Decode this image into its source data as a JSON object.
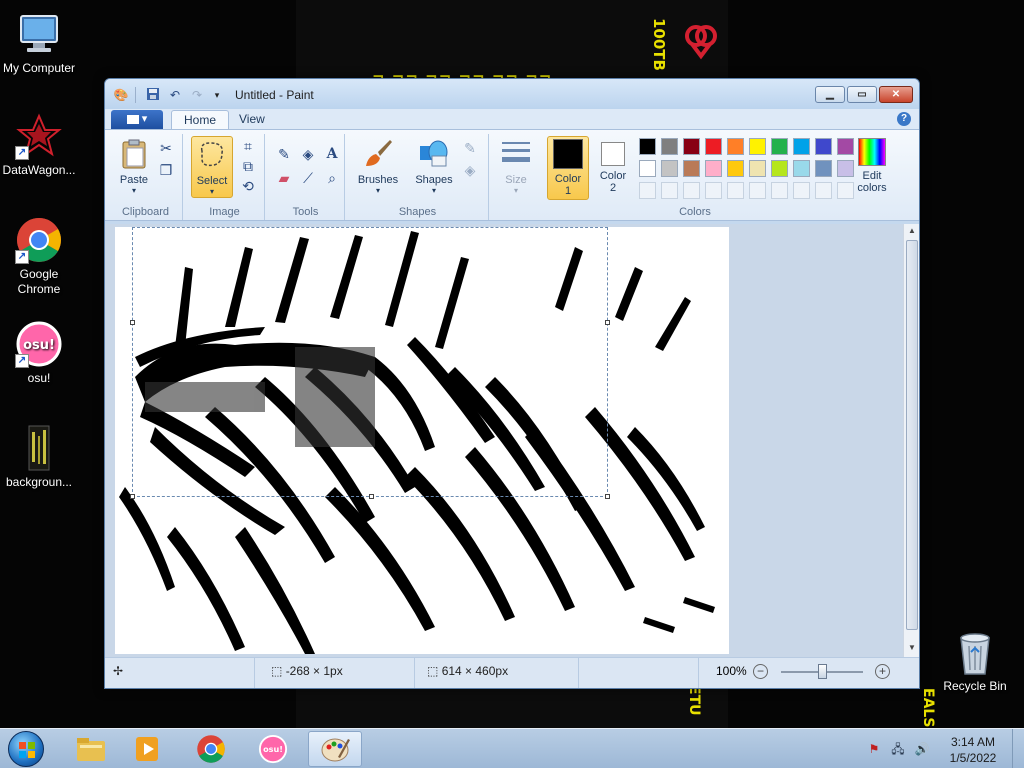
{
  "desktop": {
    "icons": [
      {
        "label": "My Computer",
        "icon": "computer-icon"
      },
      {
        "label": "DataWagon...",
        "icon": "datawagon-icon"
      },
      {
        "label": "Google Chrome",
        "icon": "chrome-icon"
      },
      {
        "label": "osu!",
        "icon": "osu-icon"
      },
      {
        "label": "backgroun...",
        "icon": "image-file-icon"
      },
      {
        "label": "Recycle Bin",
        "icon": "recycle-bin-icon"
      }
    ],
    "wallpaper": {
      "vertical_text": "100TB",
      "bottom_text_left": "ETU",
      "bottom_text_right": "EALS"
    }
  },
  "paint": {
    "title": "Untitled - Paint",
    "file_menu_label": "▾",
    "tabs": [
      "Home",
      "View"
    ],
    "active_tab": "Home",
    "groups": {
      "clipboard": {
        "label": "Clipboard",
        "paste": "Paste"
      },
      "image": {
        "label": "Image",
        "select": "Select"
      },
      "tools": {
        "label": "Tools"
      },
      "shapes": {
        "label": "Shapes",
        "brushes": "Brushes",
        "shapes_btn": "Shapes"
      },
      "size": {
        "label": "Size"
      },
      "colors": {
        "label": "Colors",
        "color1": "Color\n1",
        "color1_a": "Color",
        "color1_b": "1",
        "color2_a": "Color",
        "color2_b": "2",
        "edit_a": "Edit",
        "edit_b": "colors"
      }
    },
    "palette_row1": [
      "#000000",
      "#7f7f7f",
      "#880015",
      "#ed1c24",
      "#ff7f27",
      "#fff200",
      "#22b14c",
      "#00a2e8",
      "#3f48cc",
      "#a349a4"
    ],
    "palette_row2": [
      "#ffffff",
      "#c3c3c3",
      "#b97a57",
      "#ffaec9",
      "#ffc90e",
      "#efe4b0",
      "#b5e61d",
      "#99d9ea",
      "#7092be",
      "#c8bfe7"
    ],
    "color1_value": "#000000",
    "color2_value": "#ffffff",
    "status": {
      "cursor_pos": "-268 × 1px",
      "image_size": "614 × 460px",
      "zoom": "100%"
    }
  },
  "taskbar": {
    "clock_time": "3:14 AM",
    "clock_date": "1/5/2022"
  }
}
